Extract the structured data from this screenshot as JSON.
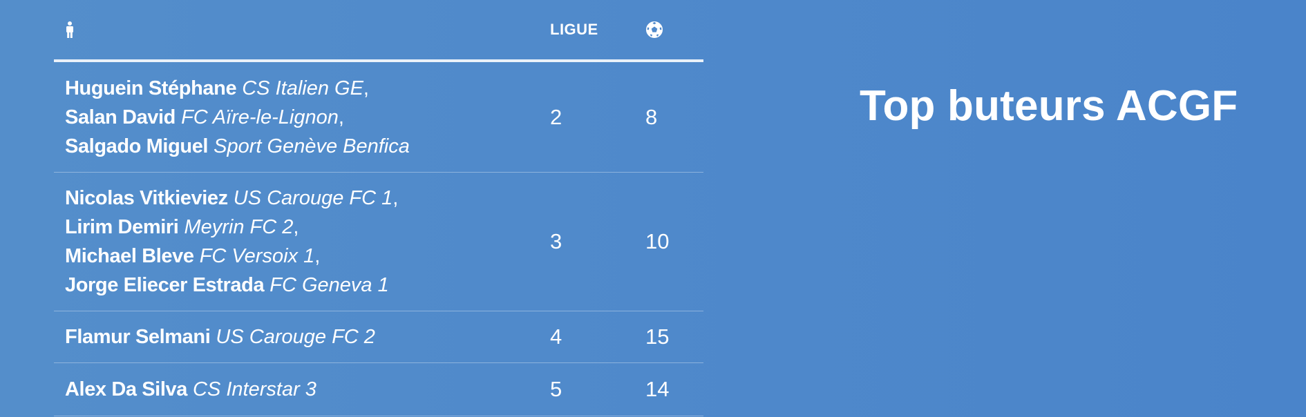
{
  "title": "Top buteurs ACGF",
  "table": {
    "headers": {
      "player_icon": "person-icon",
      "league": "LIGUE",
      "goals_icon": "soccer-ball-icon"
    },
    "rows": [
      {
        "scorers": [
          {
            "name": "Huguein Stéphane",
            "club": "CS Italien GE",
            "sep": ","
          },
          {
            "name": "Salan David",
            "club": "FC Aïre-le-Lignon",
            "sep": ","
          },
          {
            "name": "Salgado Miguel",
            "club": "Sport Genève Benfica",
            "sep": ""
          }
        ],
        "league": "2",
        "goals": "8"
      },
      {
        "scorers": [
          {
            "name": "Nicolas Vitkieviez",
            "club": "US Carouge FC 1",
            "sep": ","
          },
          {
            "name": "Lirim Demiri",
            "club": "Meyrin FC 2",
            "sep": ","
          },
          {
            "name": "Michael Bleve",
            "club": "FC Versoix 1",
            "sep": ","
          },
          {
            "name": "Jorge Eliecer Estrada",
            "club": "FC Geneva 1",
            "sep": ""
          }
        ],
        "league": "3",
        "goals": "10"
      },
      {
        "scorers": [
          {
            "name": "Flamur Selmani",
            "club": "US Carouge FC 2",
            "sep": ""
          }
        ],
        "league": "4",
        "goals": "15"
      },
      {
        "scorers": [
          {
            "name": "Alex Da Silva",
            "club": "CS Interstar 3",
            "sep": ""
          }
        ],
        "league": "5",
        "goals": "14"
      }
    ]
  }
}
